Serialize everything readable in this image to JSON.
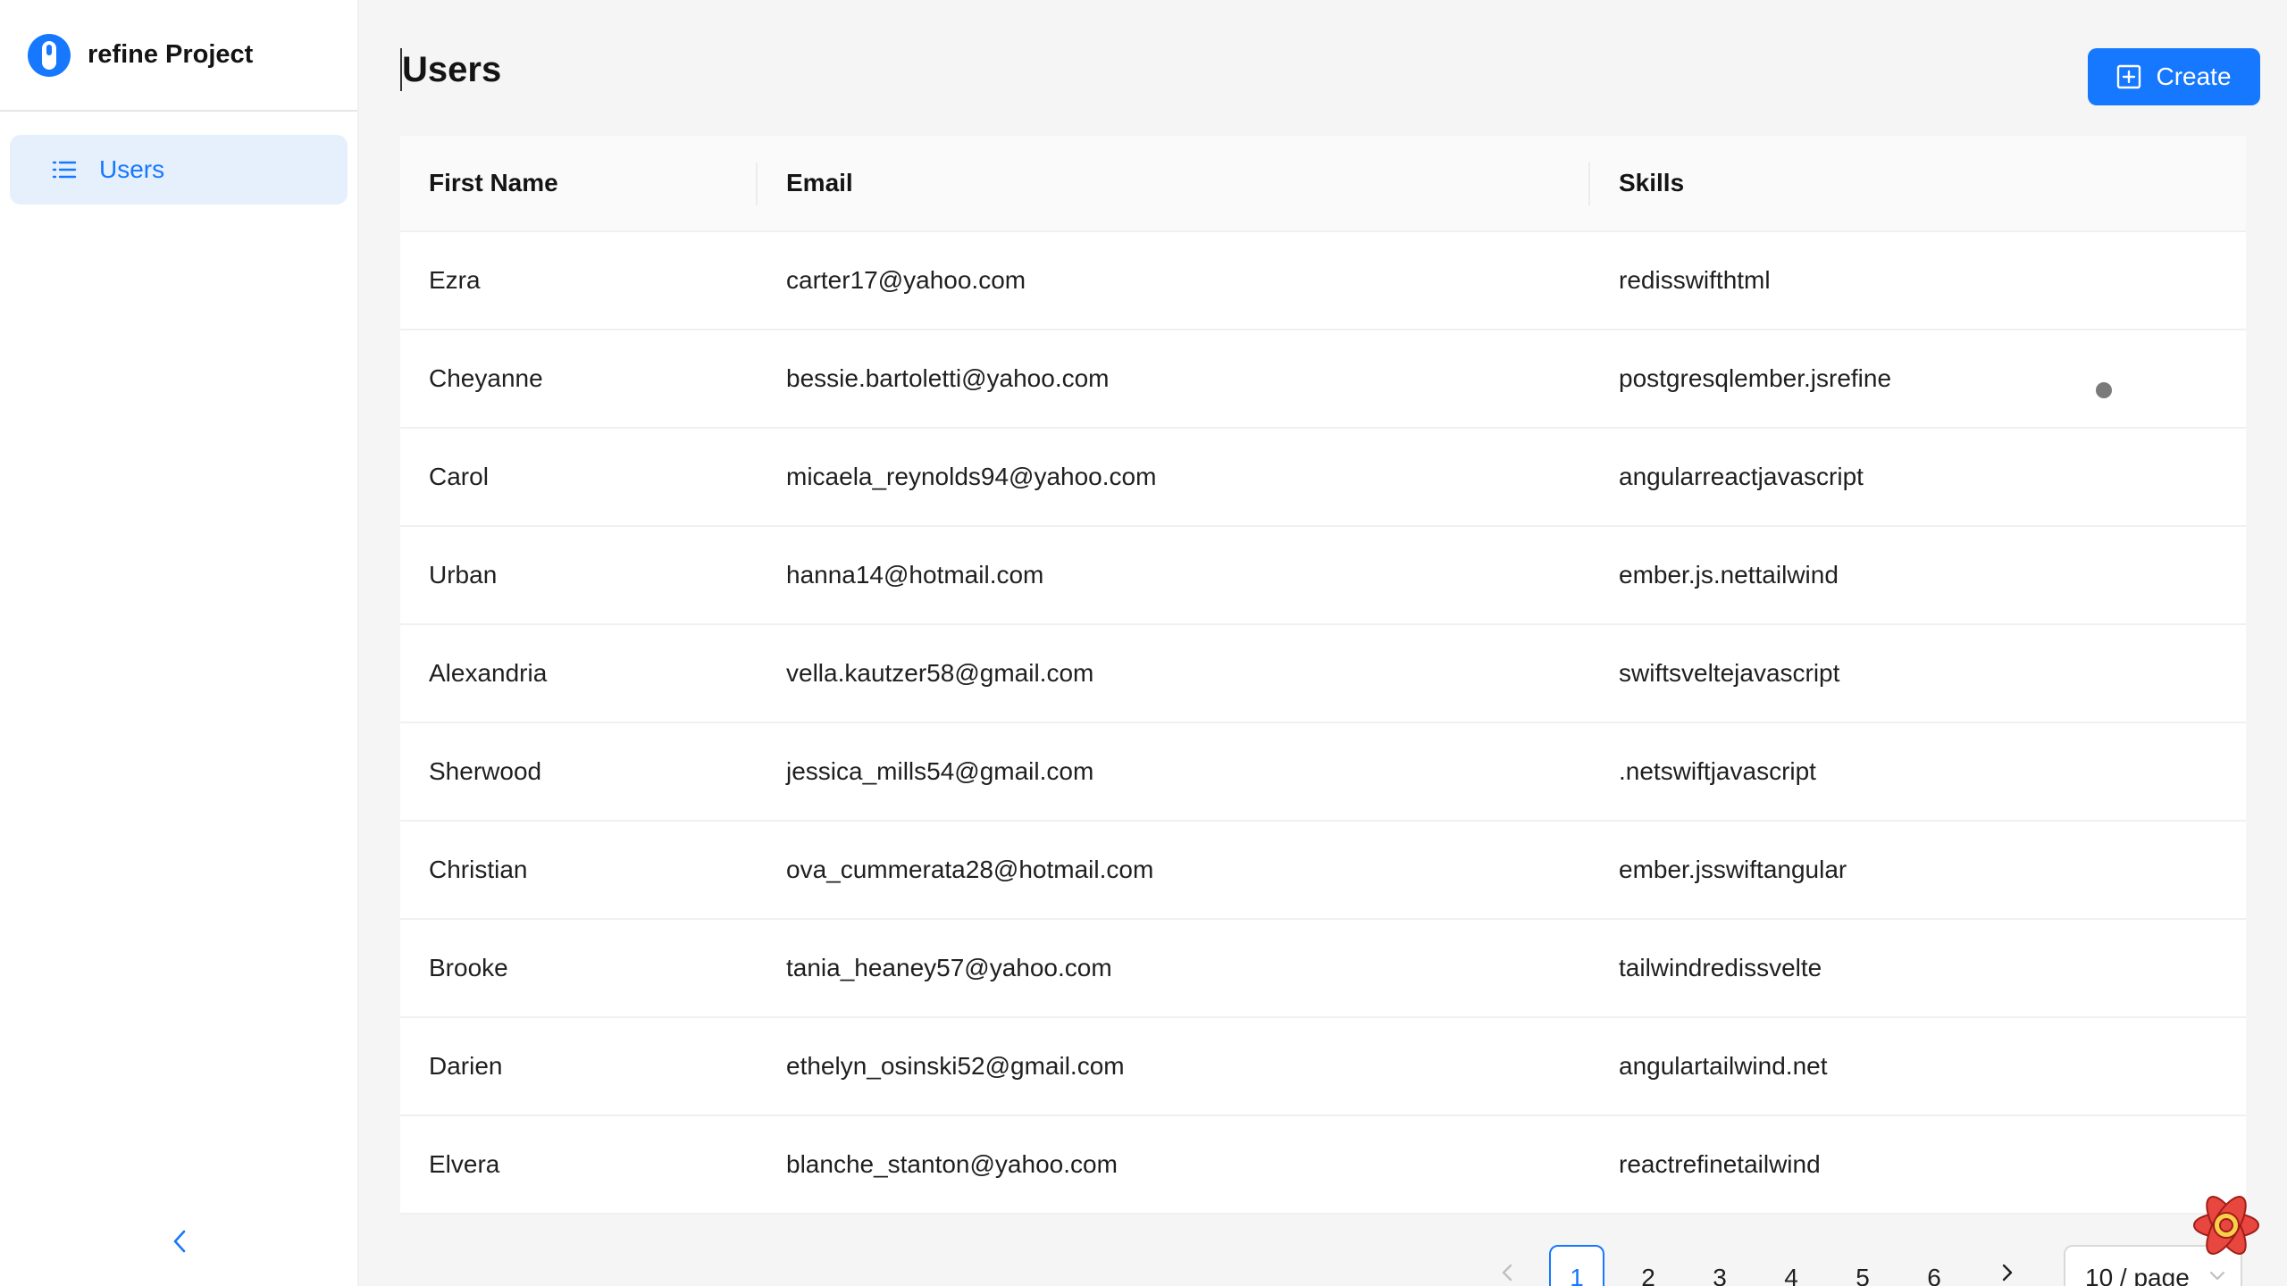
{
  "app": {
    "title": "refine Project"
  },
  "sidebar": {
    "items": [
      {
        "label": "Users",
        "icon": "list-icon",
        "active": true
      }
    ],
    "collapse_icon": "chevron-left-icon"
  },
  "page": {
    "title": "Users",
    "create_label": "Create",
    "create_icon": "plus-square-icon"
  },
  "table": {
    "columns": [
      "First Name",
      "Email",
      "Skills"
    ],
    "rows": [
      {
        "first_name": "Ezra",
        "email": "carter17@yahoo.com",
        "skills": "redisswifthtml"
      },
      {
        "first_name": "Cheyanne",
        "email": "bessie.bartoletti@yahoo.com",
        "skills": "postgresqlember.jsrefine"
      },
      {
        "first_name": "Carol",
        "email": "micaela_reynolds94@yahoo.com",
        "skills": "angularreactjavascript"
      },
      {
        "first_name": "Urban",
        "email": "hanna14@hotmail.com",
        "skills": "ember.js.nettailwind"
      },
      {
        "first_name": "Alexandria",
        "email": "vella.kautzer58@gmail.com",
        "skills": "swiftsveltejavascript"
      },
      {
        "first_name": "Sherwood",
        "email": "jessica_mills54@gmail.com",
        "skills": ".netswiftjavascript"
      },
      {
        "first_name": "Christian",
        "email": "ova_cummerata28@hotmail.com",
        "skills": "ember.jsswiftangular"
      },
      {
        "first_name": "Brooke",
        "email": "tania_heaney57@yahoo.com",
        "skills": "tailwindredissvelte"
      },
      {
        "first_name": "Darien",
        "email": "ethelyn_osinski52@gmail.com",
        "skills": "angulartailwind.net"
      },
      {
        "first_name": "Elvera",
        "email": "blanche_stanton@yahoo.com",
        "skills": "reactrefinetailwind"
      }
    ]
  },
  "pagination": {
    "pages": [
      "1",
      "2",
      "3",
      "4",
      "5",
      "6"
    ],
    "current": "1",
    "page_size_label": "10 / page"
  },
  "colors": {
    "accent": "#1677ff",
    "active_menu_bg": "#e6f0fd"
  }
}
